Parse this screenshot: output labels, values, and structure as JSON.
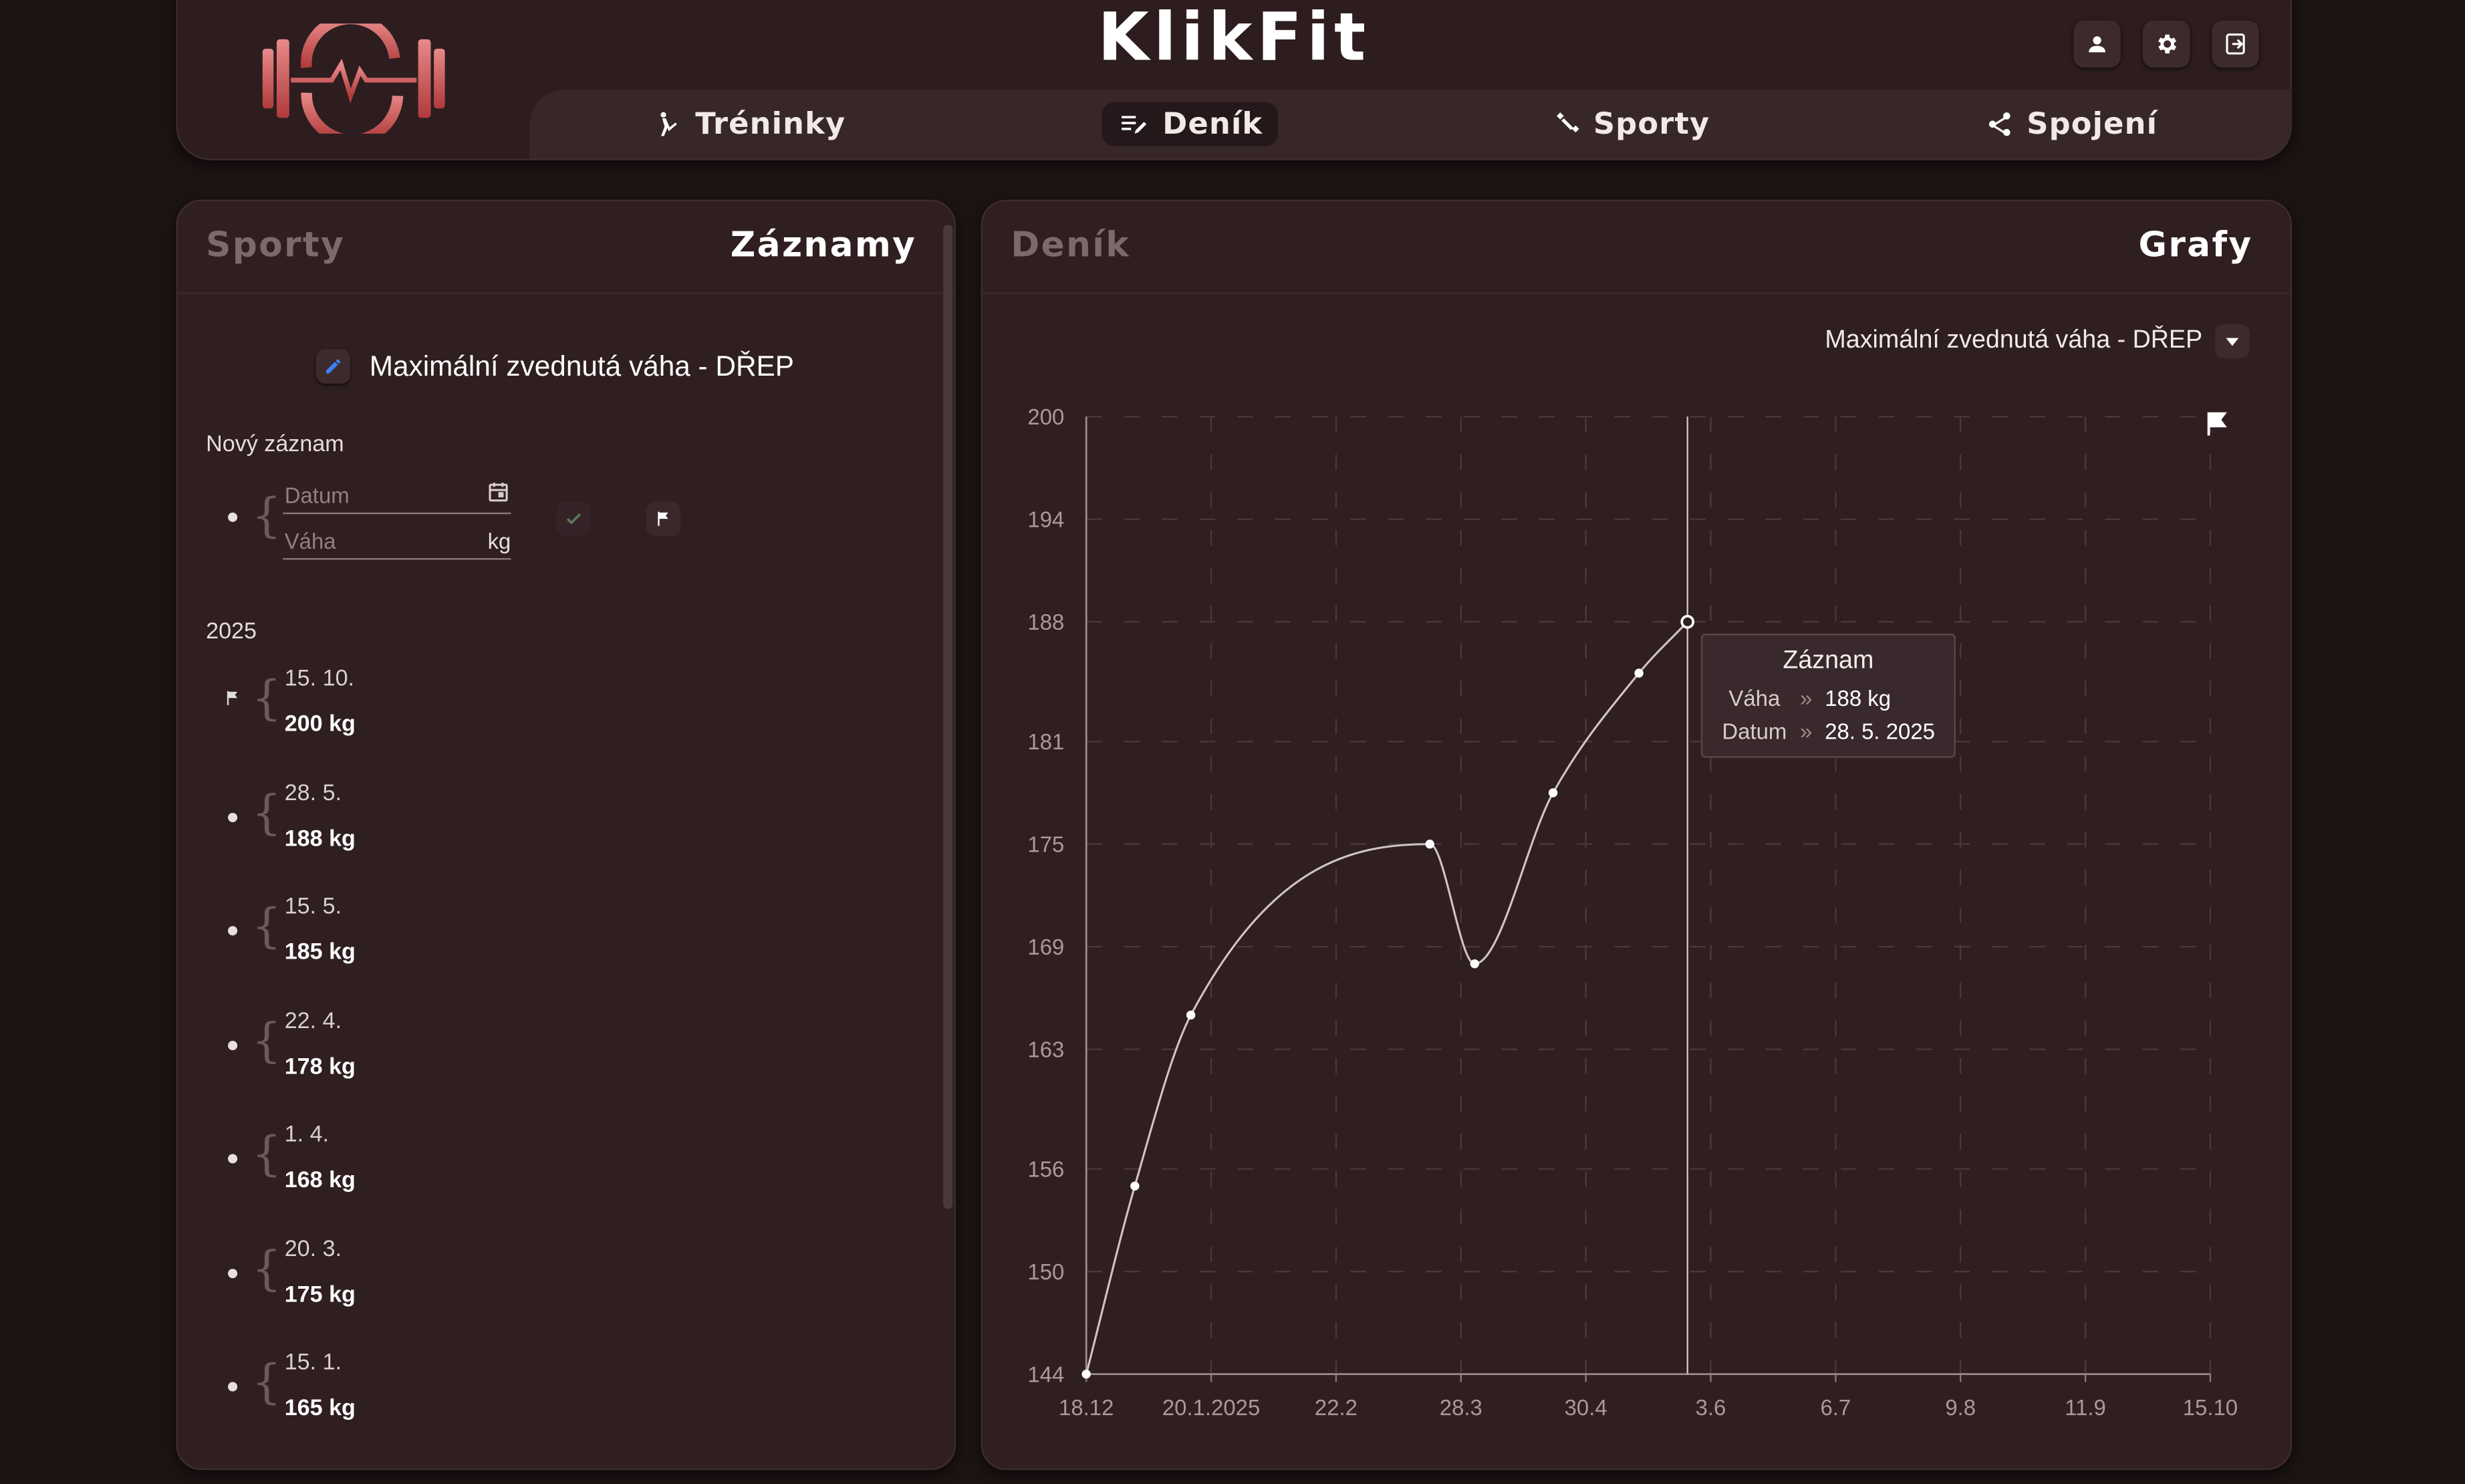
{
  "app": {
    "title": "KlikFit"
  },
  "nav": [
    {
      "label": "Tréninky",
      "icon": "kick-icon"
    },
    {
      "label": "Deník",
      "icon": "journal-edit-icon",
      "active": true
    },
    {
      "label": "Sporty",
      "icon": "dumbbell-icon"
    },
    {
      "label": "Spojení",
      "icon": "share-icon"
    }
  ],
  "header_icons": [
    "user-icon",
    "gear-icon",
    "logout-icon"
  ],
  "left_panel": {
    "tab_inactive": "Sporty",
    "tab_active": "Záznamy",
    "sport_title": "Maximální zvednutá váha - DŘEP",
    "new_entry_label": "Nový záznam",
    "date_placeholder": "Datum",
    "weight_placeholder": "Váha",
    "weight_unit": "kg",
    "year": "2025",
    "entries": [
      {
        "date": "15. 10.",
        "value": "200 kg",
        "marker": "flag"
      },
      {
        "date": "28. 5.",
        "value": "188 kg",
        "marker": "dot"
      },
      {
        "date": "15. 5.",
        "value": "185 kg",
        "marker": "dot"
      },
      {
        "date": "22. 4.",
        "value": "178 kg",
        "marker": "dot"
      },
      {
        "date": "1. 4.",
        "value": "168 kg",
        "marker": "dot"
      },
      {
        "date": "20. 3.",
        "value": "175 kg",
        "marker": "dot"
      },
      {
        "date": "15. 1.",
        "value": "165 kg",
        "marker": "dot"
      }
    ]
  },
  "right_panel": {
    "tab_inactive": "Deník",
    "tab_active": "Grafy",
    "selected_sport": "Maximální zvednutá váha - DŘEP"
  },
  "tooltip": {
    "title": "Záznam",
    "weight_label": "Váha",
    "weight_value": "188 kg",
    "date_label": "Datum",
    "date_value": "28. 5. 2025",
    "separator": "»"
  },
  "chart_data": {
    "type": "line",
    "x_ticks": [
      "18.12",
      "20.1.2025",
      "22.2",
      "28.3",
      "30.4",
      "3.6",
      "6.7",
      "9.8",
      "11.9",
      "15.10"
    ],
    "y_ticks": [
      144,
      150,
      156,
      163,
      169,
      175,
      181,
      188,
      194,
      200
    ],
    "ylim": [
      144,
      200
    ],
    "xlim": [
      "2024-12-18",
      "2025-10-15"
    ],
    "series": [
      {
        "x": [
          "2024-12-18",
          "2024-12-31",
          "2025-01-15",
          "2025-03-20",
          "2025-04-01",
          "2025-04-22",
          "2025-05-15",
          "2025-05-28"
        ],
        "y": [
          144,
          155,
          165,
          175,
          168,
          178,
          185,
          188
        ],
        "color": "#cfc5c5"
      }
    ],
    "goal": {
      "x": "2025-10-15",
      "y": 200,
      "marker": "flag"
    },
    "highlight_x": "2025-05-28",
    "grid": true
  }
}
